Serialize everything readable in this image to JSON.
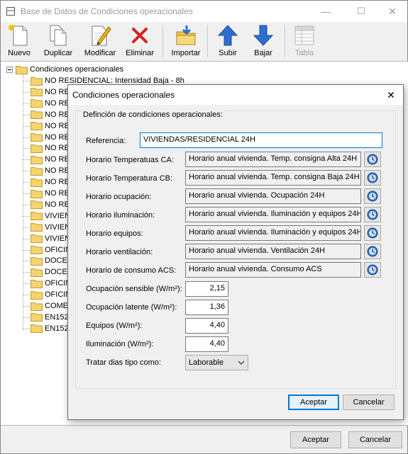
{
  "window": {
    "title": "Base de Datos de Condiciones operacionales",
    "controls": {
      "minimize": "—",
      "maximize": "☐",
      "close": "✕"
    }
  },
  "toolbar": {
    "items": [
      {
        "label": "Nuevo",
        "icon": "new-document-icon",
        "enabled": true
      },
      {
        "label": "Duplicar",
        "icon": "duplicate-icon",
        "enabled": true
      },
      {
        "label": "Modificar",
        "icon": "edit-pencil-icon",
        "enabled": true
      },
      {
        "label": "Eliminar",
        "icon": "delete-x-icon",
        "enabled": true
      },
      {
        "label": "Importar",
        "icon": "import-folder-icon",
        "enabled": true
      },
      {
        "label": "Subir",
        "icon": "arrow-up-icon",
        "enabled": true
      },
      {
        "label": "Bajar",
        "icon": "arrow-down-icon",
        "enabled": true
      },
      {
        "label": "Tabla",
        "icon": "table-icon",
        "enabled": false
      }
    ]
  },
  "tree": {
    "root": "Condiciones operacionales",
    "items": [
      "NO RESIDENCIAL: Intensidad Baja - 8h",
      "NO RE",
      "NO RE",
      "NO RE",
      "NO RE",
      "NO RE",
      "NO RE",
      "NO RE",
      "NO RE",
      "NO RE",
      "NO RE",
      "NO RE",
      "VIVIEN",
      "VIVIEN",
      "VIVIEN",
      "OFICIN",
      "DOCEN",
      "DOCEN",
      "OFICIN",
      "OFICIN",
      "COMER",
      "EN152",
      "EN152"
    ]
  },
  "main_buttons": {
    "accept": "Aceptar",
    "cancel": "Cancelar"
  },
  "dialog": {
    "title": "Condiciones operacionales",
    "close": "✕",
    "group_title": "Definción de condiciones operacionales:",
    "reference_label": "Referencia:",
    "reference_value": "VIVIENDAS/RESIDENCIAL 24H",
    "schedules": [
      {
        "label": "Horario Temperatuas CA:",
        "value": "Horario anual vivienda. Temp. consigna Alta 24H"
      },
      {
        "label": "Horario Temperatura CB:",
        "value": "Horario anual vivienda. Temp. consigna Baja 24H"
      },
      {
        "label": "Horario ocupación:",
        "value": "Horario anual vivienda. Ocupación 24H"
      },
      {
        "label": "Horario iluminación:",
        "value": "Horario anual vivienda. Iluminación y equipos 24H"
      },
      {
        "label": "Horario equipos:",
        "value": "Horario anual vivienda. Iluminación y equipos 24H"
      },
      {
        "label": "Horario ventilación:",
        "value": "Horario anual vivienda. Ventilación 24H"
      },
      {
        "label": "Horario de consumo ACS:",
        "value": "Horario anual vivienda. Consumo ACS"
      }
    ],
    "numerics": [
      {
        "label": "Ocupación sensible (W/m²):",
        "value": "2,15"
      },
      {
        "label": "Ocupación latente (W/m²):",
        "value": "1,36"
      },
      {
        "label": "Equipos (W/m²):",
        "value": "4,40"
      },
      {
        "label": "Iluminación (W/m²):",
        "value": "4,40"
      }
    ],
    "day_type_label": "Tratar dias tipo como:",
    "day_type_value": "Laborable",
    "accept": "Aceptar",
    "cancel": "Cancelar"
  },
  "colors": {
    "accent": "#0078d7",
    "folder": "#f5d46e"
  }
}
